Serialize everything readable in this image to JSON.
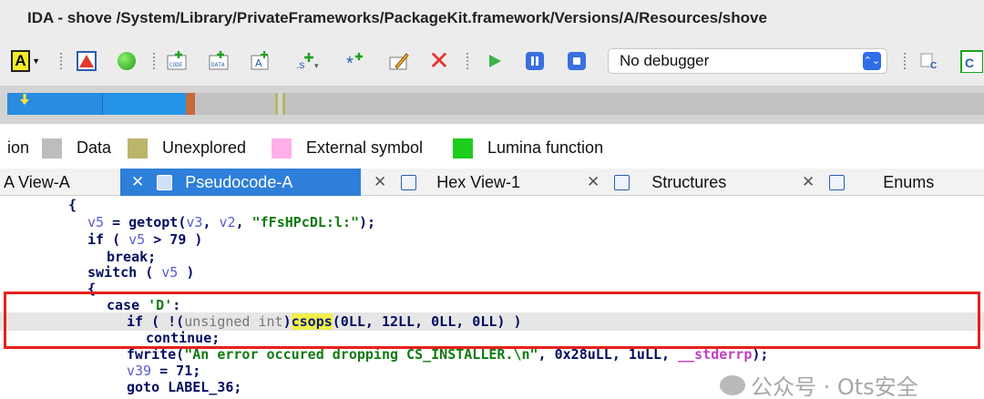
{
  "window": {
    "title": "IDA - shove /System/Library/PrivateFrameworks/PackageKit.framework/Versions/A/Resources/shove"
  },
  "toolbar": {
    "font_label": "A",
    "debugger_select": "No debugger"
  },
  "legend": [
    {
      "label": "ion",
      "color": ""
    },
    {
      "label": "Data",
      "color": "#bdbdbd"
    },
    {
      "label": "Unexplored",
      "color": "#b9b56b"
    },
    {
      "label": "External symbol",
      "color": "#ffb0e8"
    },
    {
      "label": "Lumina function",
      "color": "#1ccd1c"
    }
  ],
  "tabs": [
    {
      "label": "A View-A"
    },
    {
      "label": "Pseudocode-A",
      "active": true
    },
    {
      "label": "Hex View-1"
    },
    {
      "label": "Structures"
    },
    {
      "label": "Enums"
    }
  ],
  "code": {
    "l1": "{",
    "l2a": "v5",
    "l2b": " = getopt(",
    "l2c": "v3",
    "l2d": ", ",
    "l2e": "v2",
    "l2f": ", ",
    "l2g": "\"fFsHPcDL:l:\"",
    "l2h": ");",
    "l3a": "if ( ",
    "l3b": "v5",
    "l3c": " > 79 )",
    "l4": "break;",
    "l5a": "switch ( ",
    "l5b": "v5",
    "l5c": " )",
    "l6": "{",
    "l7a": "case ",
    "l7b": "'D'",
    "l7c": ":",
    "l8a": "if ( !(",
    "l8b": "unsigned int",
    "l8c": ")",
    "l8d": "csops",
    "l8e": "(0LL, 12LL, 0LL, 0LL) )",
    "l9": "continue;",
    "l10a": "fwrite(",
    "l10b": "\"An error occured dropping CS_INSTALLER.\\n\"",
    "l10c": ", 0x28uLL, 1uLL, ",
    "l10d": "__stderrp",
    "l10e": ");",
    "l11a": "v39",
    "l11b": " = 71;",
    "l12": "goto LABEL_36;"
  },
  "watermark": {
    "text": "公众号 · Ots安全"
  },
  "colors": {
    "accent": "#2d7fd9",
    "highlight_box": "#e8201c",
    "csops_highlight": "#f1f04a",
    "string": "#117a11"
  }
}
